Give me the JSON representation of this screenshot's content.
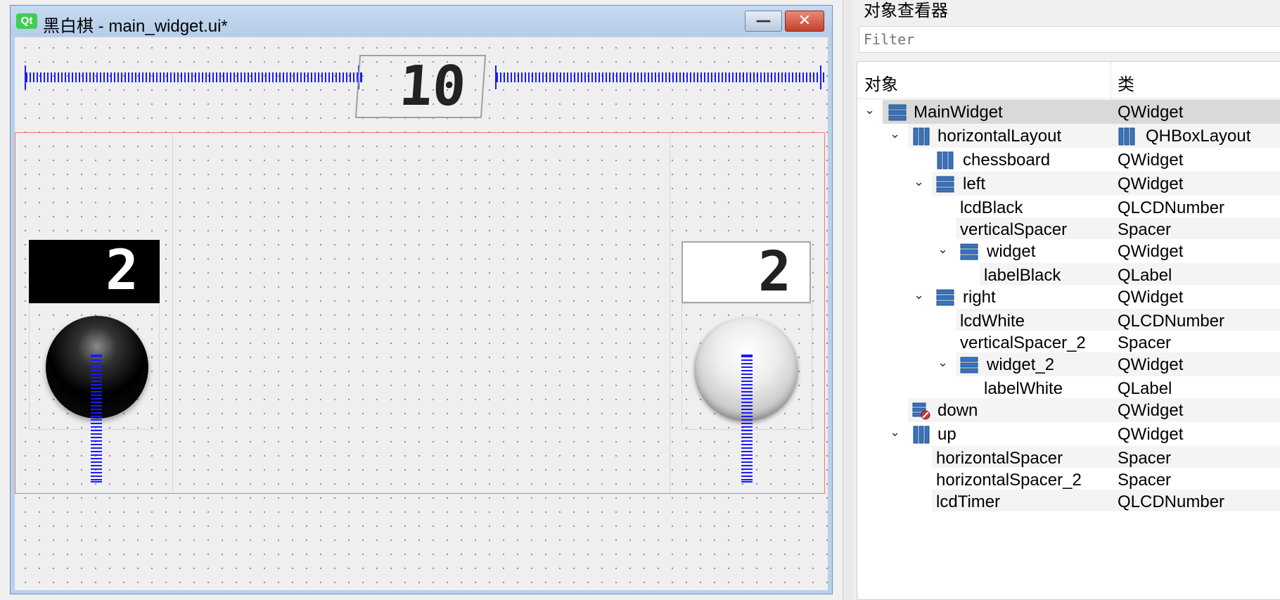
{
  "form_window": {
    "logo_text": "Qt",
    "title": "黑白棋 - main_widget.ui*",
    "minimize_glyph": "—",
    "close_glyph": "✕"
  },
  "form": {
    "lcd_timer": "10",
    "lcd_black": "2",
    "lcd_white": "2"
  },
  "inspector": {
    "title": "对象查看器",
    "filter_placeholder": "Filter",
    "columns": [
      "对象",
      "类"
    ],
    "rows": [
      {
        "name": "MainWidget",
        "class": "QWidget"
      },
      {
        "name": "horizontalLayout",
        "class": "QHBoxLayout"
      },
      {
        "name": "chessboard",
        "class": "QWidget"
      },
      {
        "name": "left",
        "class": "QWidget"
      },
      {
        "name": "lcdBlack",
        "class": "QLCDNumber"
      },
      {
        "name": "verticalSpacer",
        "class": "Spacer"
      },
      {
        "name": "widget",
        "class": "QWidget"
      },
      {
        "name": "labelBlack",
        "class": "QLabel"
      },
      {
        "name": "right",
        "class": "QWidget"
      },
      {
        "name": "lcdWhite",
        "class": "QLCDNumber"
      },
      {
        "name": "verticalSpacer_2",
        "class": "Spacer"
      },
      {
        "name": "widget_2",
        "class": "QWidget"
      },
      {
        "name": "labelWhite",
        "class": "QLabel"
      },
      {
        "name": "down",
        "class": "QWidget"
      },
      {
        "name": "up",
        "class": "QWidget"
      },
      {
        "name": "horizontalSpacer",
        "class": "Spacer"
      },
      {
        "name": "horizontalSpacer_2",
        "class": "Spacer"
      },
      {
        "name": "lcdTimer",
        "class": "QLCDNumber"
      }
    ]
  }
}
